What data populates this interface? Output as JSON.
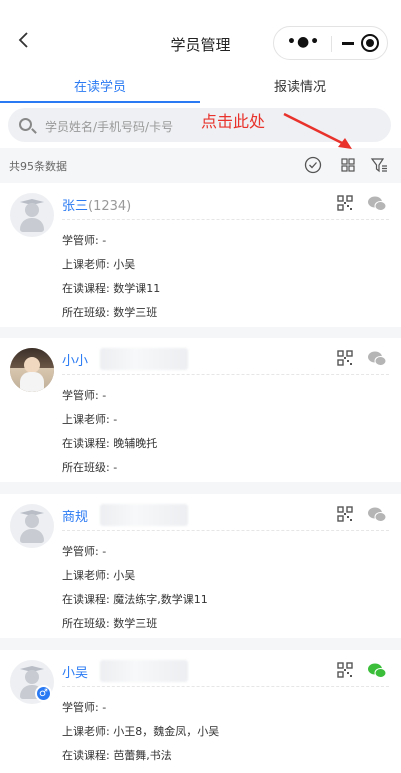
{
  "header": {
    "title": "学员管理",
    "more_icon": "•●•"
  },
  "tabs": [
    {
      "label": "在读学员",
      "active": true
    },
    {
      "label": "报读情况",
      "active": false
    }
  ],
  "search": {
    "placeholder": "学员姓名/手机号码/卡号"
  },
  "annotation": {
    "text": "点击此处",
    "color": "#e8322b"
  },
  "toolbar": {
    "count_text": "共95条数据"
  },
  "field_labels": {
    "manager": "学管师: ",
    "teacher": "上课老师: ",
    "course": "在读课程: ",
    "class": "所在班级: "
  },
  "students": [
    {
      "name": "张三",
      "id_text": "(1234)",
      "manager": "-",
      "teacher": "小吴",
      "course": "数学课11",
      "class": "数学三班",
      "wechat_active": false
    },
    {
      "name": "小小",
      "id_text": "",
      "manager": "-",
      "teacher": "-",
      "course": "晚辅晚托",
      "class": "-",
      "wechat_active": false
    },
    {
      "name": "商规",
      "id_text": "",
      "manager": "-",
      "teacher": "小吴",
      "course": "魔法练字,数学课11",
      "class": "数学三班",
      "wechat_active": false
    },
    {
      "name": "小吴",
      "id_text": "",
      "manager": "-",
      "teacher": "小王8，魏金凤，小吴",
      "course": "芭蕾舞,书法",
      "class": "",
      "wechat_active": true,
      "gender_symbol": "♂"
    }
  ],
  "colors": {
    "accent": "#2a7af3",
    "wechat_active": "#3bbf3b",
    "wechat_inactive": "#b5b5b5"
  }
}
